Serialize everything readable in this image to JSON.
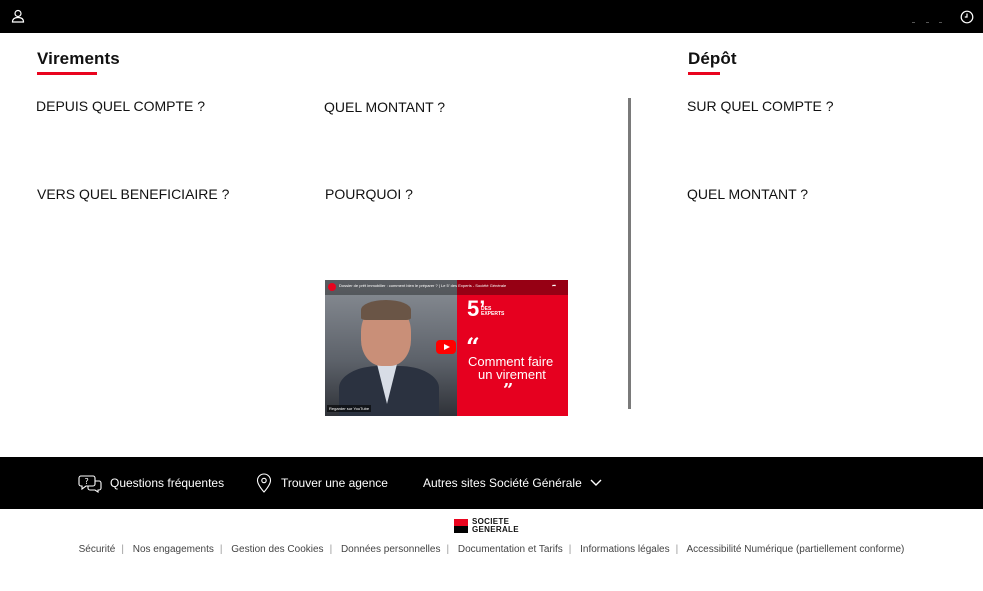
{
  "topbar": {
    "user_icon": "user-icon",
    "history_icon": "clock-icon"
  },
  "virements": {
    "title": "Virements",
    "from_account": "DEPUIS QUEL COMPTE ?",
    "amount": "QUEL MONTANT ?",
    "beneficiary": "VERS QUEL BENEFICIAIRE ?",
    "reason": "POURQUOI ?"
  },
  "depot": {
    "title": "Dépôt",
    "account": "SUR QUEL COMPTE ?",
    "amount": "QUEL MONTANT ?"
  },
  "video": {
    "top_title": "Dossier de prêt immobilier : comment bien le préparer ? | Le 5' des Experts - Société Générale",
    "five": "5’",
    "experts": "DES\nEXPERTS",
    "open_quote": "“",
    "line1": "Comment faire",
    "line2": "un virement",
    "close_quote": "”",
    "watch_on": "Regarder sur YouTube"
  },
  "footer": {
    "faq": "Questions fréquentes",
    "agency": "Trouver une agence",
    "other_sites": "Autres sites Société Générale"
  },
  "brand": {
    "line1": "SOCIETE",
    "line2": "GENERALE",
    "accent": "#e9041e"
  },
  "links": [
    "Sécurité",
    "Nos engagements",
    "Gestion des Cookies",
    "Données personnelles",
    "Documentation et Tarifs",
    "Informations légales",
    "Accessibilité Numérique (partiellement conforme)"
  ]
}
